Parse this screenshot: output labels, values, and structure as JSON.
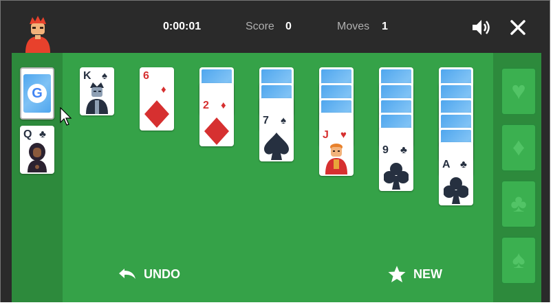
{
  "game": {
    "timer": "0:00:01",
    "score_label": "Score",
    "score_value": "0",
    "moves_label": "Moves",
    "moves_value": "1"
  },
  "controls": {
    "undo_label": "UNDO",
    "new_label": "NEW"
  },
  "stock": {
    "logo_letter": "G",
    "waste_card": {
      "rank": "Q",
      "suit": "♣"
    }
  },
  "tableau": [
    {
      "rank": "K",
      "suit": "♠",
      "color": "black",
      "face": "king"
    },
    {
      "rank": "6",
      "suit": "♦",
      "color": "red"
    },
    {
      "rank": "2",
      "suit": "♦",
      "color": "red"
    },
    {
      "rank": "7",
      "suit": "♠",
      "color": "black"
    },
    {
      "rank": "J",
      "suit": "♥",
      "color": "red",
      "face": "jack"
    },
    {
      "rank": "9",
      "suit": "♣",
      "color": "black"
    },
    {
      "rank": "A",
      "suit": "♣",
      "color": "black"
    }
  ],
  "foundations": [
    {
      "suit": "♥",
      "icon": "heart-icon"
    },
    {
      "suit": "♦",
      "icon": "diamond-icon"
    },
    {
      "suit": "♣",
      "icon": "club-icon"
    },
    {
      "suit": "♠",
      "icon": "spade-icon"
    }
  ],
  "colors": {
    "felt": "#35a248",
    "side_panel": "#2d8a3c",
    "topbar": "#2a2a2a",
    "card_back": "#4fa6ee",
    "red_suit": "#d63030",
    "black_suit": "#263040"
  }
}
